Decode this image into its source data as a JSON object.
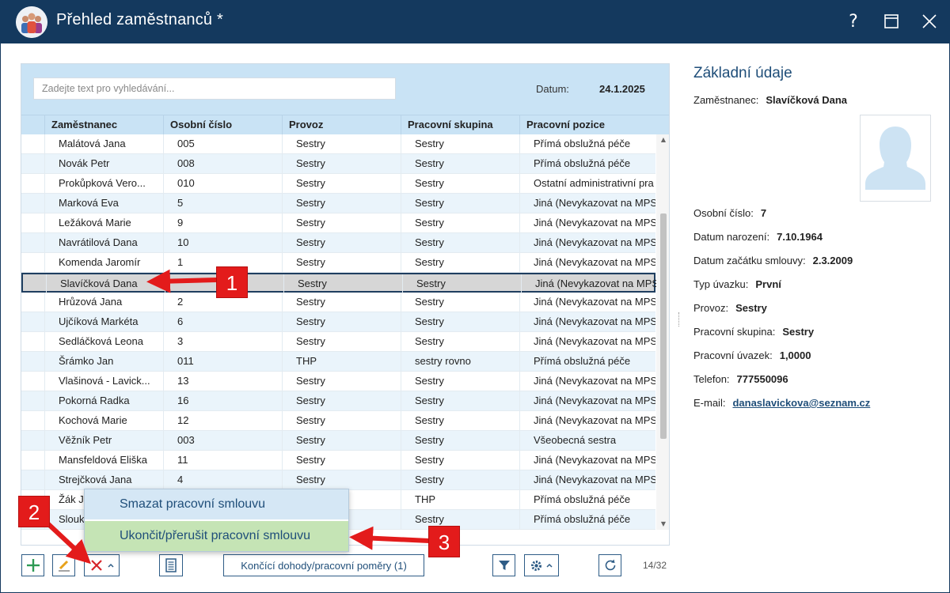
{
  "window": {
    "title": "Přehled zaměstnanců *",
    "help_label": "?",
    "maximize_label": "☐",
    "close_label": "✕"
  },
  "grid": {
    "search_placeholder": "Zadejte text pro vyhledávání...",
    "date_label": "Datum:",
    "date_value": "24.1.2025",
    "columns": [
      "Zaměstnanec",
      "Osobní číslo",
      "Provoz",
      "Pracovní skupina",
      "Pracovní pozice"
    ],
    "rows": [
      {
        "name": "Malátová Jana",
        "id": "005",
        "provoz": "Sestry",
        "skupina": "Sestry",
        "pozice": "Přímá obslužná péče"
      },
      {
        "name": "Novák Petr",
        "id": "008",
        "provoz": "Sestry",
        "skupina": "Sestry",
        "pozice": "Přímá obslužná péče"
      },
      {
        "name": "Prokůpková Vero...",
        "id": "010",
        "provoz": "Sestry",
        "skupina": "Sestry",
        "pozice": "Ostatní administrativní pra"
      },
      {
        "name": "Marková Eva",
        "id": "5",
        "provoz": "Sestry",
        "skupina": "Sestry",
        "pozice": "Jiná (Nevykazovat na MPSV"
      },
      {
        "name": "Ležáková Marie",
        "id": "9",
        "provoz": "Sestry",
        "skupina": "Sestry",
        "pozice": "Jiná (Nevykazovat na MPSV"
      },
      {
        "name": "Navrátilová Dana",
        "id": "10",
        "provoz": "Sestry",
        "skupina": "Sestry",
        "pozice": "Jiná (Nevykazovat na MPSV"
      },
      {
        "name": "Komenda Jaromír",
        "id": "1",
        "provoz": "Sestry",
        "skupina": "Sestry",
        "pozice": "Jiná (Nevykazovat na MPSV"
      },
      {
        "name": "Slavíčková Dana",
        "id": "",
        "provoz": "Sestry",
        "skupina": "Sestry",
        "pozice": "Jiná (Nevykazovat na MPSV"
      },
      {
        "name": "Hrůzová Jana",
        "id": "2",
        "provoz": "Sestry",
        "skupina": "Sestry",
        "pozice": "Jiná (Nevykazovat na MPSV"
      },
      {
        "name": "Ujčíková Markéta",
        "id": "6",
        "provoz": "Sestry",
        "skupina": "Sestry",
        "pozice": "Jiná (Nevykazovat na MPSV"
      },
      {
        "name": "Sedláčková Leona",
        "id": "3",
        "provoz": "Sestry",
        "skupina": "Sestry",
        "pozice": "Jiná (Nevykazovat na MPSV"
      },
      {
        "name": "Šrámko Jan",
        "id": "011",
        "provoz": "THP",
        "skupina": "sestry rovno",
        "pozice": "Přímá obslužná péče"
      },
      {
        "name": "Vlašinová - Lavick...",
        "id": "13",
        "provoz": "Sestry",
        "skupina": "Sestry",
        "pozice": "Jiná (Nevykazovat na MPSV"
      },
      {
        "name": "Pokorná Radka",
        "id": "16",
        "provoz": "Sestry",
        "skupina": "Sestry",
        "pozice": "Jiná (Nevykazovat na MPSV"
      },
      {
        "name": "Kochová Marie",
        "id": "12",
        "provoz": "Sestry",
        "skupina": "Sestry",
        "pozice": "Jiná (Nevykazovat na MPSV"
      },
      {
        "name": "Věžník Petr",
        "id": "003",
        "provoz": "Sestry",
        "skupina": "Sestry",
        "pozice": "Všeobecná sestra"
      },
      {
        "name": "Mansfeldová Eliška",
        "id": "11",
        "provoz": "Sestry",
        "skupina": "Sestry",
        "pozice": "Jiná (Nevykazovat na MPSV"
      },
      {
        "name": "Strejčková Jana",
        "id": "4",
        "provoz": "Sestry",
        "skupina": "Sestry",
        "pozice": "Jiná (Nevykazovat na MPSV"
      },
      {
        "name": "Žák Ja",
        "id": "",
        "provoz": "",
        "skupina": "THP",
        "pozice": "Přímá obslužná péče"
      },
      {
        "name": "Slouk",
        "id": "",
        "provoz": "",
        "skupina": "Sestry",
        "pozice": "Přímá obslužná péče"
      }
    ],
    "selected_index": 7
  },
  "menu": {
    "delete_contract": "Smazat pracovní smlouvu",
    "end_contract": "Ukončit/přerušit pracovní smlouvu"
  },
  "toolbar": {
    "add_label": "+",
    "ending_contracts_label": "Končící dohody/pracovní poměry (1)",
    "page_count": "14/32"
  },
  "detail": {
    "title": "Základní údaje",
    "fields": [
      {
        "label": "Zaměstnanec:",
        "value": "Slavíčková Dana"
      },
      {
        "label": "Osobní číslo:",
        "value": "7"
      },
      {
        "label": "Datum narození:",
        "value": "7.10.1964"
      },
      {
        "label": "Datum začátku smlouvy:",
        "value": "2.3.2009"
      },
      {
        "label": "Typ úvazku:",
        "value": "První"
      },
      {
        "label": "Provoz:",
        "value": "Sestry"
      },
      {
        "label": "Pracovní skupina:",
        "value": "Sestry"
      },
      {
        "label": "Pracovní úvazek:",
        "value": "1,0000"
      },
      {
        "label": "Telefon:",
        "value": "777550096"
      },
      {
        "label": "E-mail:",
        "value": "danaslavickova@seznam.cz"
      }
    ]
  },
  "annotations": {
    "badge_1": "1",
    "badge_2": "2",
    "badge_3": "3",
    "color": "#e31b1b"
  },
  "colors": {
    "titlebar": "#14395e",
    "header": "#c9e3f5",
    "row_alt": "#eaf4fb",
    "accent": "#1f4e79",
    "menu_highlight": "#c5e4b5"
  }
}
